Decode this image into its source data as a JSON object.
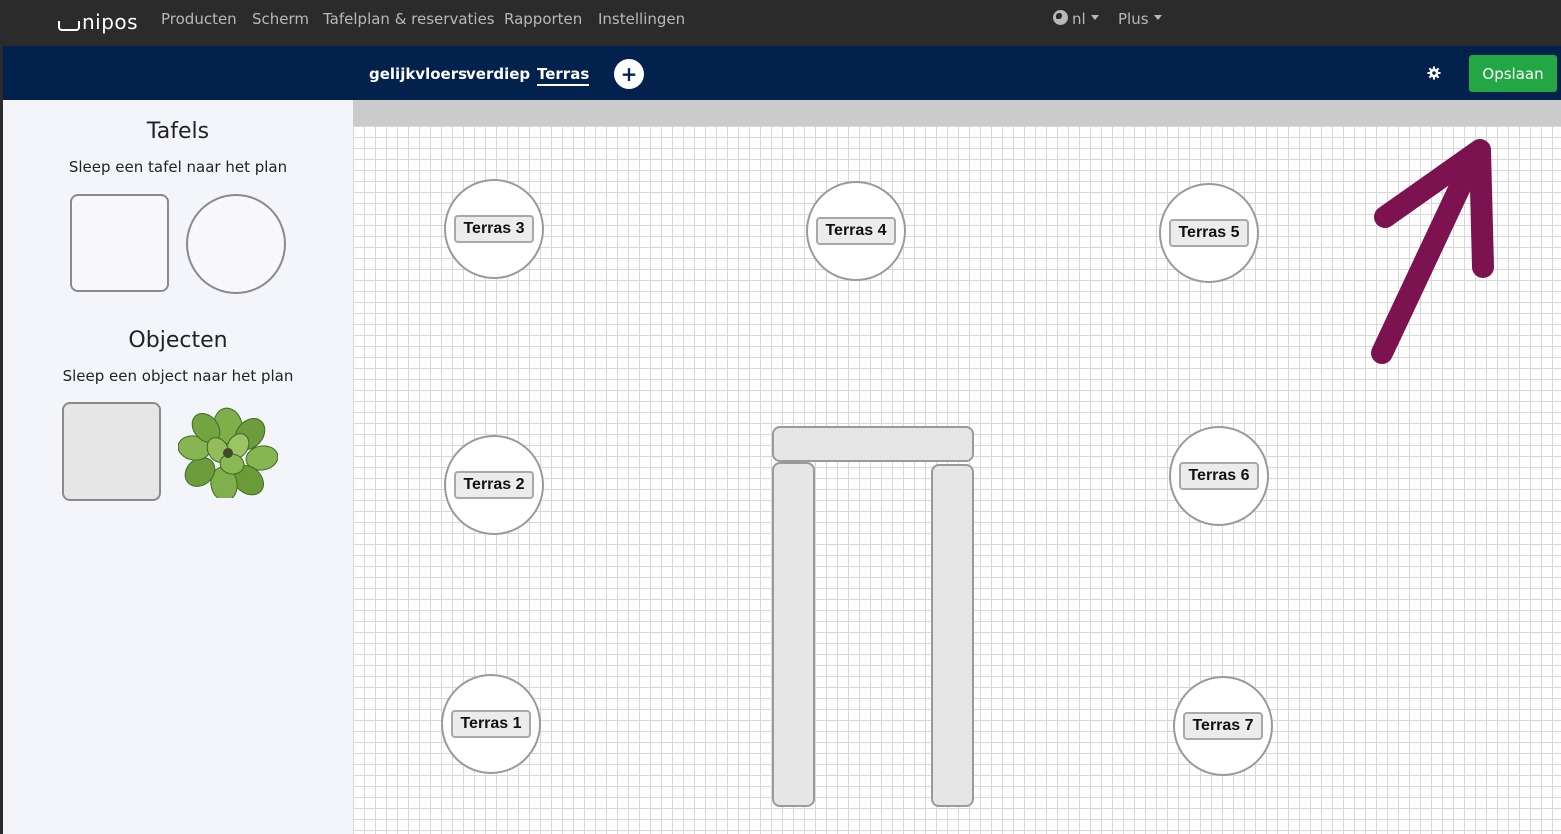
{
  "navbar": {
    "brand": "nipos",
    "links": [
      "Producten",
      "Scherm",
      "Tafelplan & reservaties",
      "Rapporten",
      "Instellingen"
    ],
    "language": "nl",
    "plus": "Plus"
  },
  "floors": {
    "tabs": [
      "gelijkvloers",
      "verdiep",
      "Terras"
    ],
    "active": "Terras",
    "add_symbol": "+",
    "save_label": "Opslaan"
  },
  "sidebar": {
    "tables_title": "Tafels",
    "tables_hint": "Sleep een tafel naar het plan",
    "objects_title": "Objecten",
    "objects_hint": "Sleep een object naar het plan"
  },
  "plan": {
    "tables": [
      {
        "label": "Terras 3",
        "shape": "round"
      },
      {
        "label": "Terras 4",
        "shape": "round"
      },
      {
        "label": "Terras 5",
        "shape": "round"
      },
      {
        "label": "Terras 2",
        "shape": "round"
      },
      {
        "label": "Terras 6",
        "shape": "round"
      },
      {
        "label": "Terras 1",
        "shape": "round"
      },
      {
        "label": "Terras 7",
        "shape": "round"
      }
    ]
  },
  "colors": {
    "topbar": "#2b2b2b",
    "floorbar": "#03214d",
    "save_button": "#23a744",
    "annotation_arrow": "#7c1350",
    "sidebar": "#f4f5fa"
  },
  "icons": {
    "globe": "globe-icon",
    "settings": "gear-icon",
    "add": "plus-icon",
    "plant": "plant-icon"
  }
}
